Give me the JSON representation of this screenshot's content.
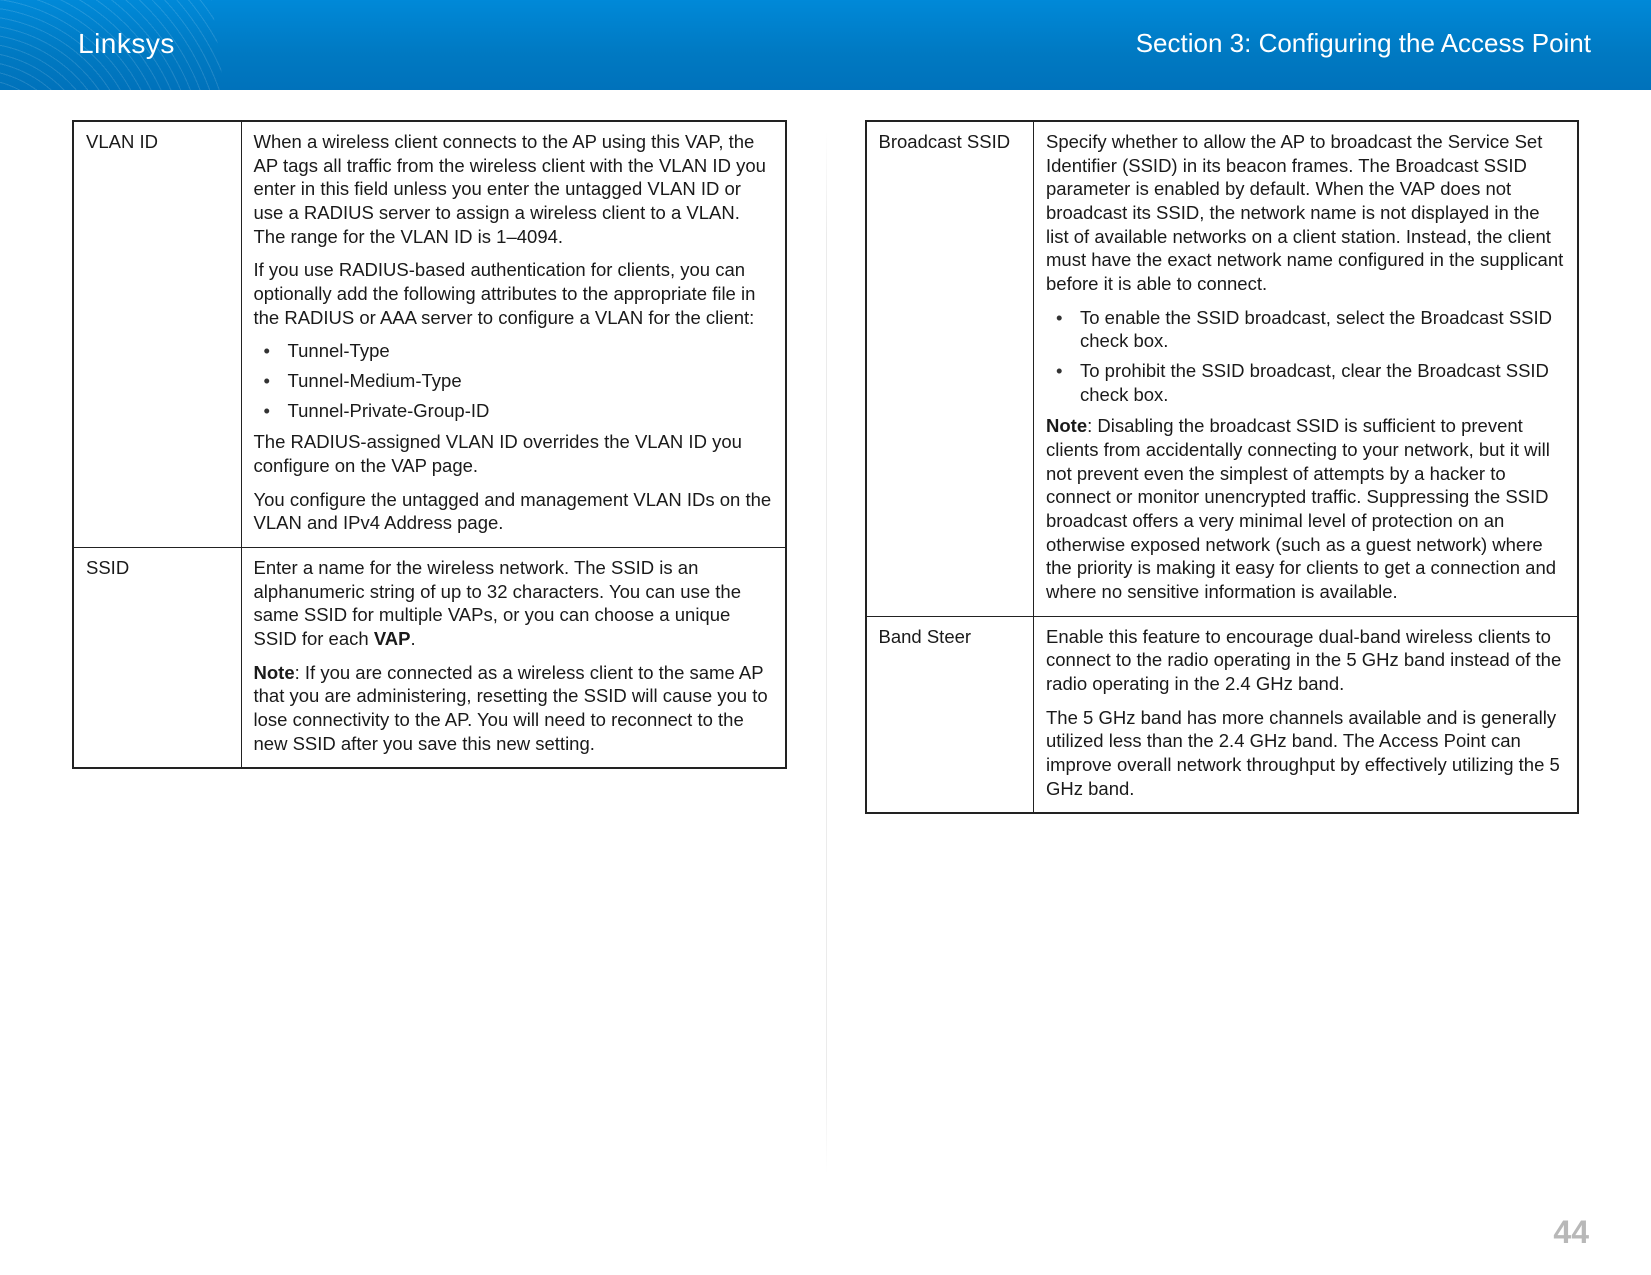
{
  "header": {
    "brand": "Linksys",
    "section": "Section 3:  Configuring the Access Point"
  },
  "page_number": "44",
  "left_table": [
    {
      "term": "VLAN ID",
      "blocks": [
        {
          "type": "p",
          "text": "When a wireless client connects to the AP using this VAP, the AP tags all traffic from the wireless client with the VLAN ID you enter in this field unless you enter the untagged VLAN ID or use a RADIUS server to assign a wireless client to a VLAN. The range for the VLAN ID is 1–4094."
        },
        {
          "type": "p",
          "text": "If you use RADIUS-based authentication for clients, you can optionally add the following attributes to the appropriate file in the RADIUS or AAA server to configure a VLAN for the client:"
        },
        {
          "type": "ul",
          "items": [
            "Tunnel-Type",
            "Tunnel-Medium-Type",
            "Tunnel-Private-Group-ID"
          ]
        },
        {
          "type": "p",
          "text": "The RADIUS-assigned VLAN ID overrides the VLAN ID you configure on the VAP page."
        },
        {
          "type": "p",
          "text": "You configure the untagged and management VLAN IDs on the VLAN and IPv4 Address page."
        }
      ]
    },
    {
      "term": "SSID",
      "blocks": [
        {
          "type": "p_bold_end",
          "pre": "Enter a name for the wireless network. The SSID is an alphanumeric string of up to 32 characters. You can use the same SSID for multiple VAPs, or you can choose a unique SSID for each ",
          "bold": "VAP",
          "post": "."
        },
        {
          "type": "note",
          "label": "Note",
          "sep": ": ",
          "text": "If you are connected as a wireless client to the same AP that you are administering, resetting the SSID will cause you to lose connectivity to the AP. You will need to reconnect to the new SSID after you save this new setting."
        }
      ]
    }
  ],
  "right_table": [
    {
      "term": "Broadcast SSID",
      "blocks": [
        {
          "type": "p",
          "text": "Specify whether to allow the AP to broadcast the Service Set Identifier (SSID) in its beacon frames. The Broadcast SSID parameter is enabled by default. When the VAP does not broadcast its SSID, the network name is not displayed in the list of available networks on a client station. Instead, the client must have the exact network name configured in the supplicant before it is able to connect."
        },
        {
          "type": "ul",
          "items": [
            "To enable the SSID broadcast, select the Broadcast SSID check box.",
            "To prohibit the SSID broadcast, clear the Broadcast SSID check box."
          ]
        },
        {
          "type": "note",
          "label": "Note",
          "sep": ":     ",
          "text": "Disabling the broadcast SSID is sufficient to prevent clients from accidentally connecting to your network, but it will not prevent even the simplest of attempts by a hacker to connect or monitor unencrypted traffic. Suppressing the SSID broadcast offers a very minimal level of protection on an otherwise exposed network (such as a guest network) where the priority is making it easy for clients to get a connection and where no sensitive information is available."
        }
      ]
    },
    {
      "term": "Band Steer",
      "blocks": [
        {
          "type": "p",
          "text": "Enable this feature to encourage dual-band wireless clients to connect to the radio operating in the 5 GHz band instead of the radio operating in the 2.4 GHz band."
        },
        {
          "type": "p",
          "text": "The 5 GHz band has more channels available and is generally utilized less than the 2.4 GHz band. The Access Point can improve overall network throughput by effectively utilizing the 5 GHz band."
        }
      ]
    }
  ]
}
